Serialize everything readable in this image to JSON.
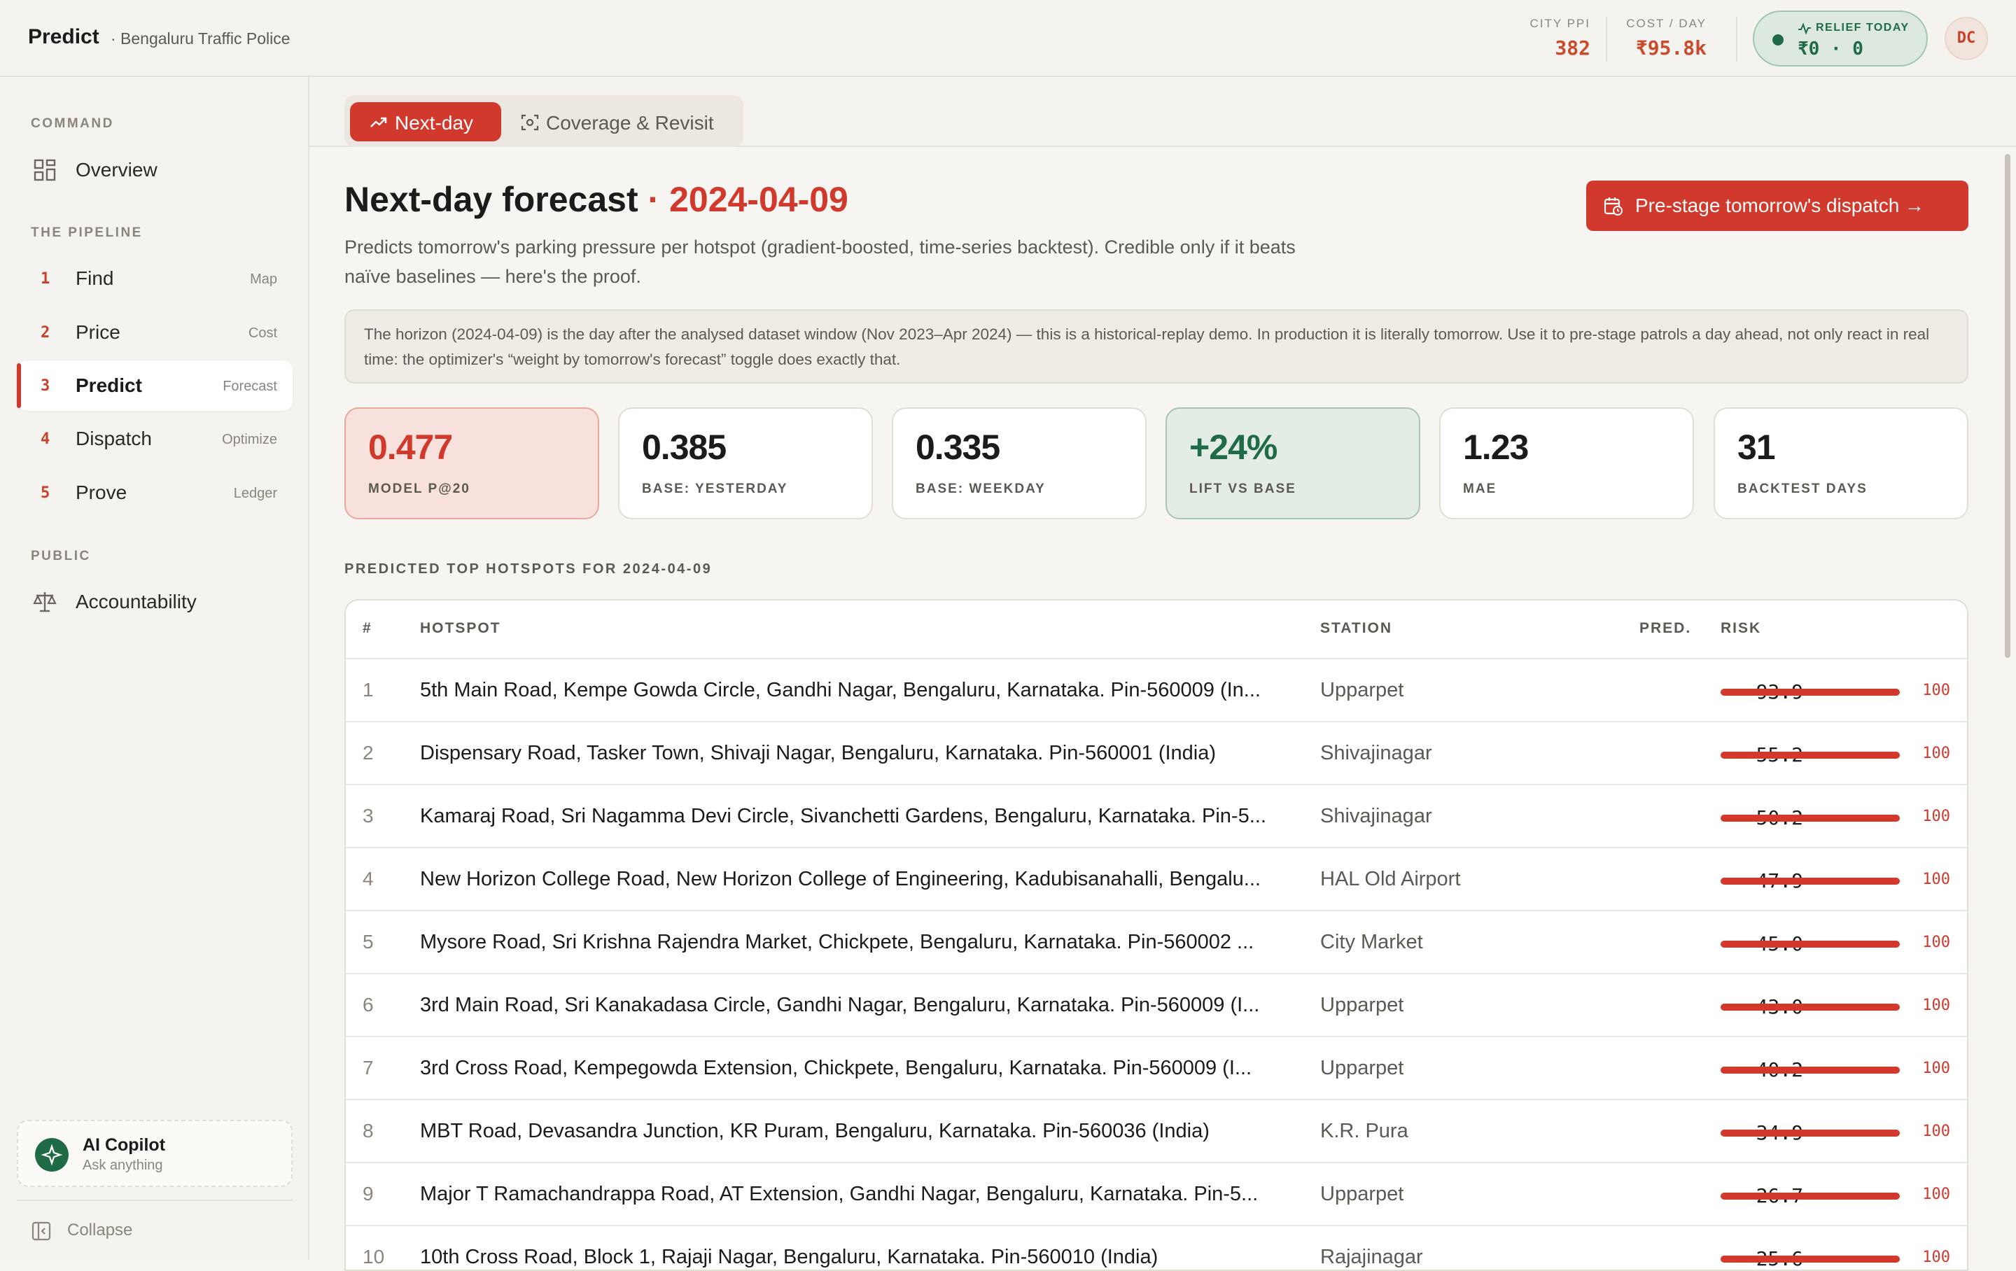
{
  "header": {
    "brand": "Predict",
    "brand_sub": "· Bengaluru Traffic Police",
    "city_ppi_label": "CITY PPI",
    "city_ppi_value": "382",
    "cost_label": "COST / DAY",
    "cost_value": "₹95.8k",
    "relief_label": "RELIEF TODAY",
    "relief_value": "₹0 · 0",
    "avatar": "DC"
  },
  "sidebar": {
    "command_label": "COMMAND",
    "overview": "Overview",
    "pipeline_label": "THE PIPELINE",
    "items": [
      {
        "num": "1",
        "label": "Find",
        "tag": "Map"
      },
      {
        "num": "2",
        "label": "Price",
        "tag": "Cost"
      },
      {
        "num": "3",
        "label": "Predict",
        "tag": "Forecast"
      },
      {
        "num": "4",
        "label": "Dispatch",
        "tag": "Optimize"
      },
      {
        "num": "5",
        "label": "Prove",
        "tag": "Ledger"
      }
    ],
    "public_label": "PUBLIC",
    "accountability": "Accountability",
    "copilot_title": "AI Copilot",
    "copilot_sub": "Ask anything",
    "collapse": "Collapse"
  },
  "tabs": {
    "active": "Next-day",
    "inactive": "Coverage & Revisit"
  },
  "main": {
    "title": "Next-day forecast",
    "title_sep": "·",
    "title_date": "2024-04-09",
    "subtitle": "Predicts tomorrow's parking pressure per hotspot (gradient-boosted, time-series backtest). Credible only if it beats naïve baselines — here's the proof.",
    "cta": "Pre-stage tomorrow's dispatch →",
    "note": "The horizon (2024-04-09) is the day after the analysed dataset window (Nov 2023–Apr 2024) — this is a historical-replay demo. In production it is literally tomorrow. Use it to pre-stage patrols a day ahead, not only react in real time: the optimizer's “weight by tomorrow's forecast” toggle does exactly that.",
    "kpis": [
      {
        "value": "0.477",
        "label": "MODEL P@20"
      },
      {
        "value": "0.385",
        "label": "BASE: YESTERDAY"
      },
      {
        "value": "0.335",
        "label": "BASE: WEEKDAY"
      },
      {
        "value": "+24%",
        "label": "LIFT VS BASE"
      },
      {
        "value": "1.23",
        "label": "MAE"
      },
      {
        "value": "31",
        "label": "BACKTEST DAYS"
      }
    ],
    "table_caption": "PREDICTED TOP HOTSPOTS FOR 2024-04-09",
    "table_headers": {
      "num": "#",
      "hotspot": "HOTSPOT",
      "station": "STATION",
      "pred": "PRED.",
      "risk": "RISK"
    },
    "rows": [
      {
        "num": "1",
        "hotspot": "5th Main Road, Kempe Gowda Circle, Gandhi Nagar, Bengaluru, Karnataka. Pin-560009 (In...",
        "station": "Upparpet",
        "pred": "93.9",
        "risk": "100"
      },
      {
        "num": "2",
        "hotspot": "Dispensary Road, Tasker Town, Shivaji Nagar, Bengaluru, Karnataka. Pin-560001 (India)",
        "station": "Shivajinagar",
        "pred": "55.2",
        "risk": "100"
      },
      {
        "num": "3",
        "hotspot": "Kamaraj Road, Sri Nagamma Devi Circle, Sivanchetti Gardens, Bengaluru, Karnataka. Pin-5...",
        "station": "Shivajinagar",
        "pred": "50.2",
        "risk": "100"
      },
      {
        "num": "4",
        "hotspot": "New Horizon College Road, New Horizon College of Engineering, Kadubisanahalli, Bengalu...",
        "station": "HAL Old Airport",
        "pred": "47.9",
        "risk": "100"
      },
      {
        "num": "5",
        "hotspot": "Mysore Road, Sri Krishna Rajendra Market, Chickpete, Bengaluru, Karnataka. Pin-560002 ...",
        "station": "City Market",
        "pred": "45.0",
        "risk": "100"
      },
      {
        "num": "6",
        "hotspot": "3rd Main Road, Sri Kanakadasa Circle, Gandhi Nagar, Bengaluru, Karnataka. Pin-560009 (I...",
        "station": "Upparpet",
        "pred": "43.0",
        "risk": "100"
      },
      {
        "num": "7",
        "hotspot": "3rd Cross Road, Kempegowda Extension, Chickpete, Bengaluru, Karnataka. Pin-560009 (I...",
        "station": "Upparpet",
        "pred": "40.2",
        "risk": "100"
      },
      {
        "num": "8",
        "hotspot": "MBT Road, Devasandra Junction, KR Puram, Bengaluru, Karnataka. Pin-560036 (India)",
        "station": "K.R. Pura",
        "pred": "34.9",
        "risk": "100"
      },
      {
        "num": "9",
        "hotspot": "Major T Ramachandrappa Road, AT Extension, Gandhi Nagar, Bengaluru, Karnataka. Pin-5...",
        "station": "Upparpet",
        "pred": "26.7",
        "risk": "100"
      },
      {
        "num": "10",
        "hotspot": "10th Cross Road, Block 1, Rajaji Nagar, Bengaluru, Karnataka. Pin-560010 (India)",
        "station": "Rajajinagar",
        "pred": "25.6",
        "risk": "100"
      }
    ]
  },
  "colors": {
    "accent": "#d0392b",
    "good": "#1f6b45",
    "background": "#f7f5f1"
  }
}
